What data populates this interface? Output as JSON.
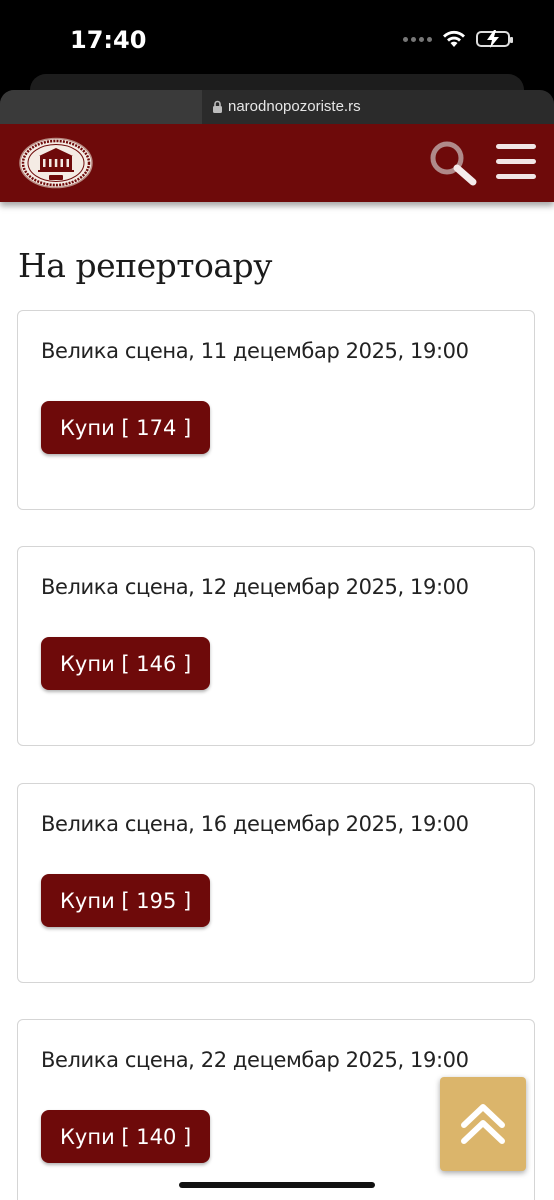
{
  "status_bar": {
    "time": "17:40",
    "icons": [
      "signal-dots-icon",
      "wifi-icon",
      "battery-charging-icon"
    ]
  },
  "browser": {
    "url": "narodnopozoriste.rs",
    "lock_icon": "lock-icon"
  },
  "header": {
    "logo_icon": "national-theatre-seal-logo",
    "search_icon": "search-icon",
    "menu_icon": "hamburger-menu-icon",
    "brand_color": "#6e0a0a"
  },
  "main": {
    "title": "На репертоару",
    "performances": [
      {
        "date": "Велика сцена, 11 децембар 2025, 19:00",
        "button": "Купи [ 174 ]"
      },
      {
        "date": "Велика сцена, 12 децембар 2025, 19:00",
        "button": "Купи [ 146 ]"
      },
      {
        "date": "Велика сцена, 16 децембар 2025, 19:00",
        "button": "Купи [ 195 ]"
      },
      {
        "date": "Велика сцена, 22 децембар 2025, 19:00",
        "button": "Купи [ 140 ]"
      }
    ]
  },
  "scroll_top": {
    "icon": "double-chevron-up-icon",
    "color": "#dbb56b"
  }
}
